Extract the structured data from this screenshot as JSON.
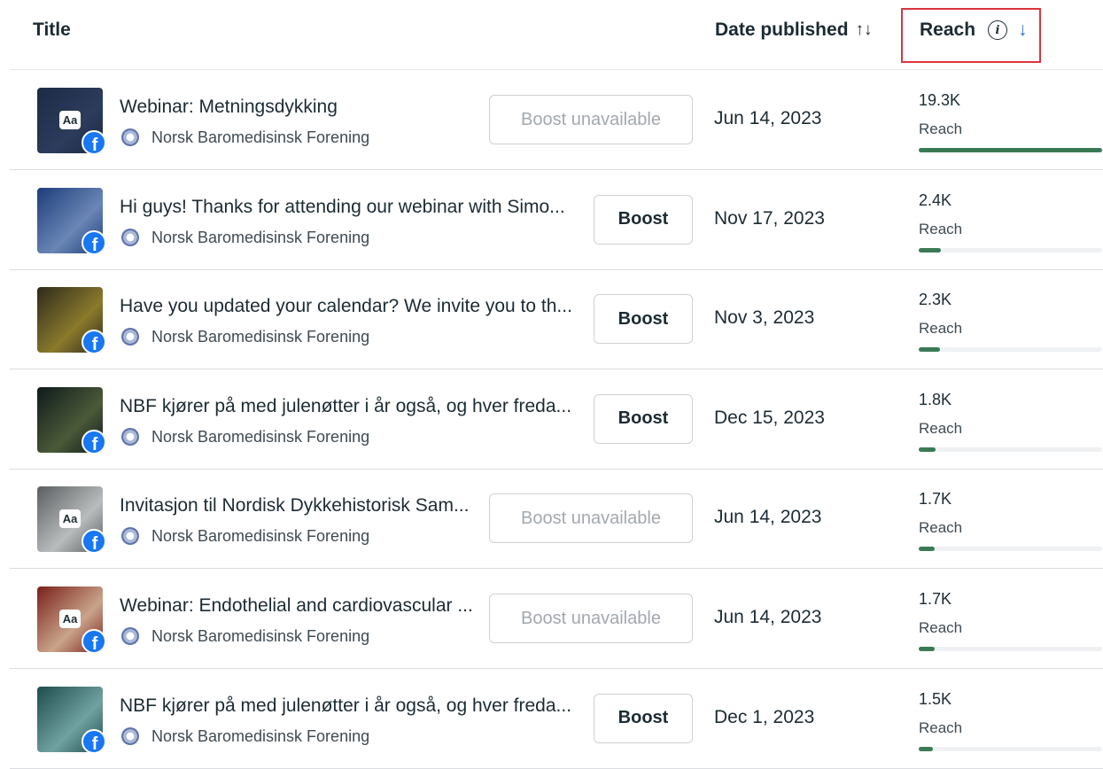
{
  "header": {
    "title": "Title",
    "date_published": "Date published",
    "sort_icon": "↑↓",
    "reach": "Reach",
    "info_icon": "i",
    "down_icon": "↓"
  },
  "posts": [
    {
      "title": "Webinar: Metningsdykking",
      "page": "Norsk Baromedisinsk Forening",
      "boost_label": "Boost unavailable",
      "boost_available": false,
      "has_text_badge": true,
      "badge": "Aa",
      "date": "Jun 14, 2023",
      "reach": "19.3K",
      "reach_label": "Reach",
      "reach_fraction": 1.0,
      "thumb_colors": [
        "#1b2a45",
        "#2d3c5c"
      ]
    },
    {
      "title": "Hi guys! Thanks for attending our webinar with Simo...",
      "page": "Norsk Baromedisinsk Forening",
      "boost_label": "Boost",
      "boost_available": true,
      "has_text_badge": false,
      "badge": "",
      "date": "Nov 17, 2023",
      "reach": "2.4K",
      "reach_label": "Reach",
      "reach_fraction": 0.12,
      "thumb_colors": [
        "#1d3d7a",
        "#6a86b6"
      ]
    },
    {
      "title": "Have you updated your calendar? We invite you to th...",
      "page": "Norsk Baromedisinsk Forening",
      "boost_label": "Boost",
      "boost_available": true,
      "has_text_badge": false,
      "badge": "",
      "date": "Nov 3, 2023",
      "reach": "2.3K",
      "reach_label": "Reach",
      "reach_fraction": 0.115,
      "thumb_colors": [
        "#2e2a1c",
        "#8a7a2c"
      ]
    },
    {
      "title": "NBF kjører på med julenøtter i år også, og hver freda...",
      "page": "Norsk Baromedisinsk Forening",
      "boost_label": "Boost",
      "boost_available": true,
      "has_text_badge": false,
      "badge": "",
      "date": "Dec 15, 2023",
      "reach": "1.8K",
      "reach_label": "Reach",
      "reach_fraction": 0.093,
      "thumb_colors": [
        "#0f1a1c",
        "#4a5a38"
      ]
    },
    {
      "title": "Invitasjon til Nordisk Dykkehistorisk Sam...",
      "page": "Norsk Baromedisinsk Forening",
      "boost_label": "Boost unavailable",
      "boost_available": false,
      "has_text_badge": true,
      "badge": "Aa",
      "date": "Jun 14, 2023",
      "reach": "1.7K",
      "reach_label": "Reach",
      "reach_fraction": 0.088,
      "thumb_colors": [
        "#5a5e60",
        "#b9bcbd"
      ]
    },
    {
      "title": "Webinar: Endothelial and cardiovascular ...",
      "page": "Norsk Baromedisinsk Forening",
      "boost_label": "Boost unavailable",
      "boost_available": false,
      "has_text_badge": true,
      "badge": "Aa",
      "date": "Jun 14, 2023",
      "reach": "1.7K",
      "reach_label": "Reach",
      "reach_fraction": 0.088,
      "thumb_colors": [
        "#7a1f1a",
        "#c9a48a"
      ]
    },
    {
      "title": "NBF kjører på med julenøtter i år også, og hver freda...",
      "page": "Norsk Baromedisinsk Forening",
      "boost_label": "Boost",
      "boost_available": true,
      "has_text_badge": false,
      "badge": "",
      "date": "Dec 1, 2023",
      "reach": "1.5K",
      "reach_label": "Reach",
      "reach_fraction": 0.078,
      "thumb_colors": [
        "#1e4c4c",
        "#6fa2a0"
      ]
    }
  ]
}
